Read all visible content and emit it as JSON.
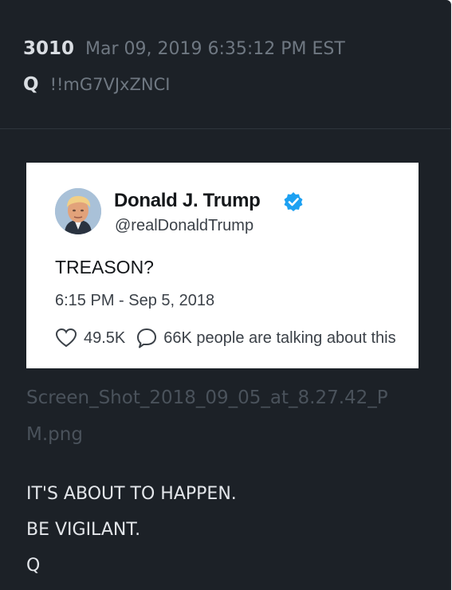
{
  "post": {
    "number": "3010",
    "date": "Mar 09, 2019 6:35:12 PM EST",
    "author": "Q",
    "tripcode": "!!mG7VJxZNCI"
  },
  "tweet": {
    "name": "Donald J. Trump",
    "handle": "@realDonaldTrump",
    "text": "TREASON?",
    "time": "6:15 PM - Sep 5, 2018",
    "likes": "49.5K",
    "talking": "66K people are talking about this",
    "verified_color": "#1da1f2",
    "icons": [
      "verified-badge-icon",
      "heart-icon",
      "speech-bubble-icon"
    ]
  },
  "attachment": {
    "filename": "Screen_Shot_2018_09_05_at_8.27.42_PM.png"
  },
  "message": {
    "lines": [
      "IT'S ABOUT TO HAPPEN.",
      "BE VIGILANT.",
      "Q"
    ]
  }
}
